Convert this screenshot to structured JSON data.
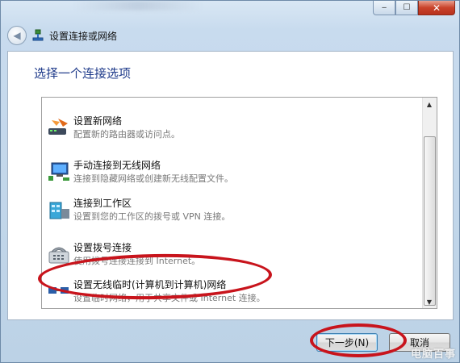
{
  "window": {
    "minimize_glyph": "‒",
    "maximize_glyph": "☐",
    "close_glyph": "✕"
  },
  "nav": {
    "back_glyph": "◀",
    "title": "设置连接或网络"
  },
  "heading": "选择一个连接选项",
  "options": [
    {
      "title": "设置新网络",
      "description": "配置新的路由器或访问点。",
      "icon": "router-icon"
    },
    {
      "title": "手动连接到无线网络",
      "description": "连接到隐藏网络或创建新无线配置文件。",
      "icon": "wireless-network-icon"
    },
    {
      "title": "连接到工作区",
      "description": "设置到您的工作区的拨号或 VPN 连接。",
      "icon": "workplace-icon"
    },
    {
      "title": "设置拨号连接",
      "description": "使用拨号连接连接到 Internet。",
      "icon": "dialup-phone-icon"
    },
    {
      "title": "设置无线临时(计算机到计算机)网络",
      "description": "设置临时网络，用于共享文件或 Internet 连接。",
      "icon": "adhoc-network-icon"
    }
  ],
  "scrollbar": {
    "up_glyph": "▲",
    "down_glyph": "▼"
  },
  "buttons": {
    "next": "下一步(N)",
    "cancel": "取消"
  },
  "watermark": "电脑百事"
}
